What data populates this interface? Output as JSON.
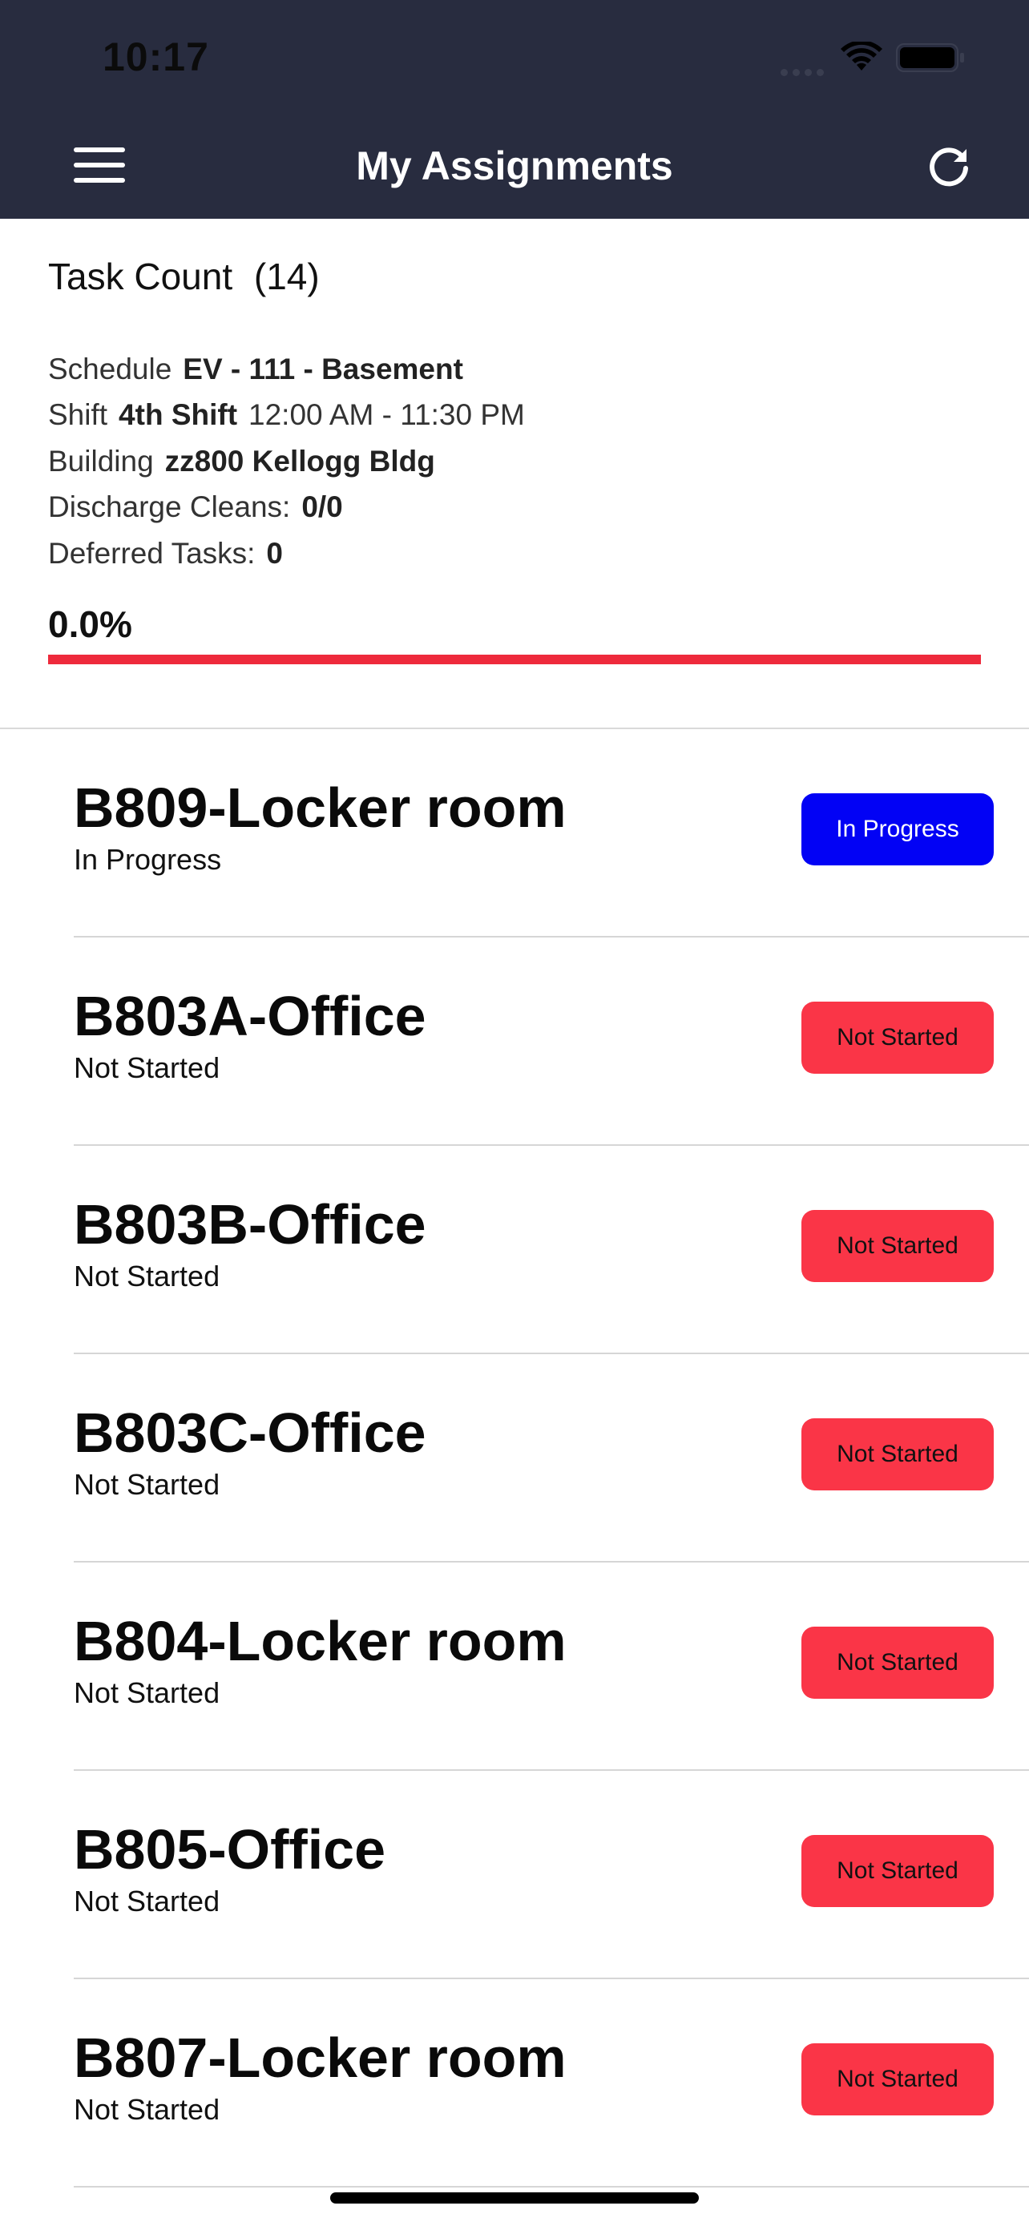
{
  "status_bar": {
    "time": "10:17",
    "icons": [
      "signal-icon",
      "wifi-icon",
      "battery-icon"
    ]
  },
  "header": {
    "title": "My Assignments",
    "menu_icon": "hamburger-menu-icon",
    "refresh_icon": "refresh-icon",
    "background": "#282c3f"
  },
  "summary": {
    "task_count_label": "Task Count",
    "task_count_value": "(14)",
    "schedule_label": "Schedule",
    "schedule_value": "EV - 111 - Basement",
    "shift_label": "Shift",
    "shift_value": "4th Shift",
    "shift_hours": "12:00 AM - 11:30 PM",
    "building_label": "Building",
    "building_value": "zz800 Kellogg Bldg",
    "discharge_label": "Discharge Cleans:",
    "discharge_value": "0/0",
    "deferred_label": "Deferred Tasks:",
    "deferred_value": "0",
    "progress_text": "0.0%",
    "progress_fraction": 0.0,
    "progress_track_color": "#ee2a3c"
  },
  "colors": {
    "in_progress": "#0202f5",
    "not_started": "#fa3547"
  },
  "assignments": [
    {
      "title": "B809-Locker room",
      "status": "In Progress",
      "button": "In Progress"
    },
    {
      "title": "B803A-Office",
      "status": "Not Started",
      "button": "Not Started"
    },
    {
      "title": "B803B-Office",
      "status": "Not Started",
      "button": "Not Started"
    },
    {
      "title": "B803C-Office",
      "status": "Not Started",
      "button": "Not Started"
    },
    {
      "title": "B804-Locker room",
      "status": "Not Started",
      "button": "Not Started"
    },
    {
      "title": "B805-Office",
      "status": "Not Started",
      "button": "Not Started"
    },
    {
      "title": "B807-Locker room",
      "status": "Not Started",
      "button": "Not Started"
    }
  ]
}
